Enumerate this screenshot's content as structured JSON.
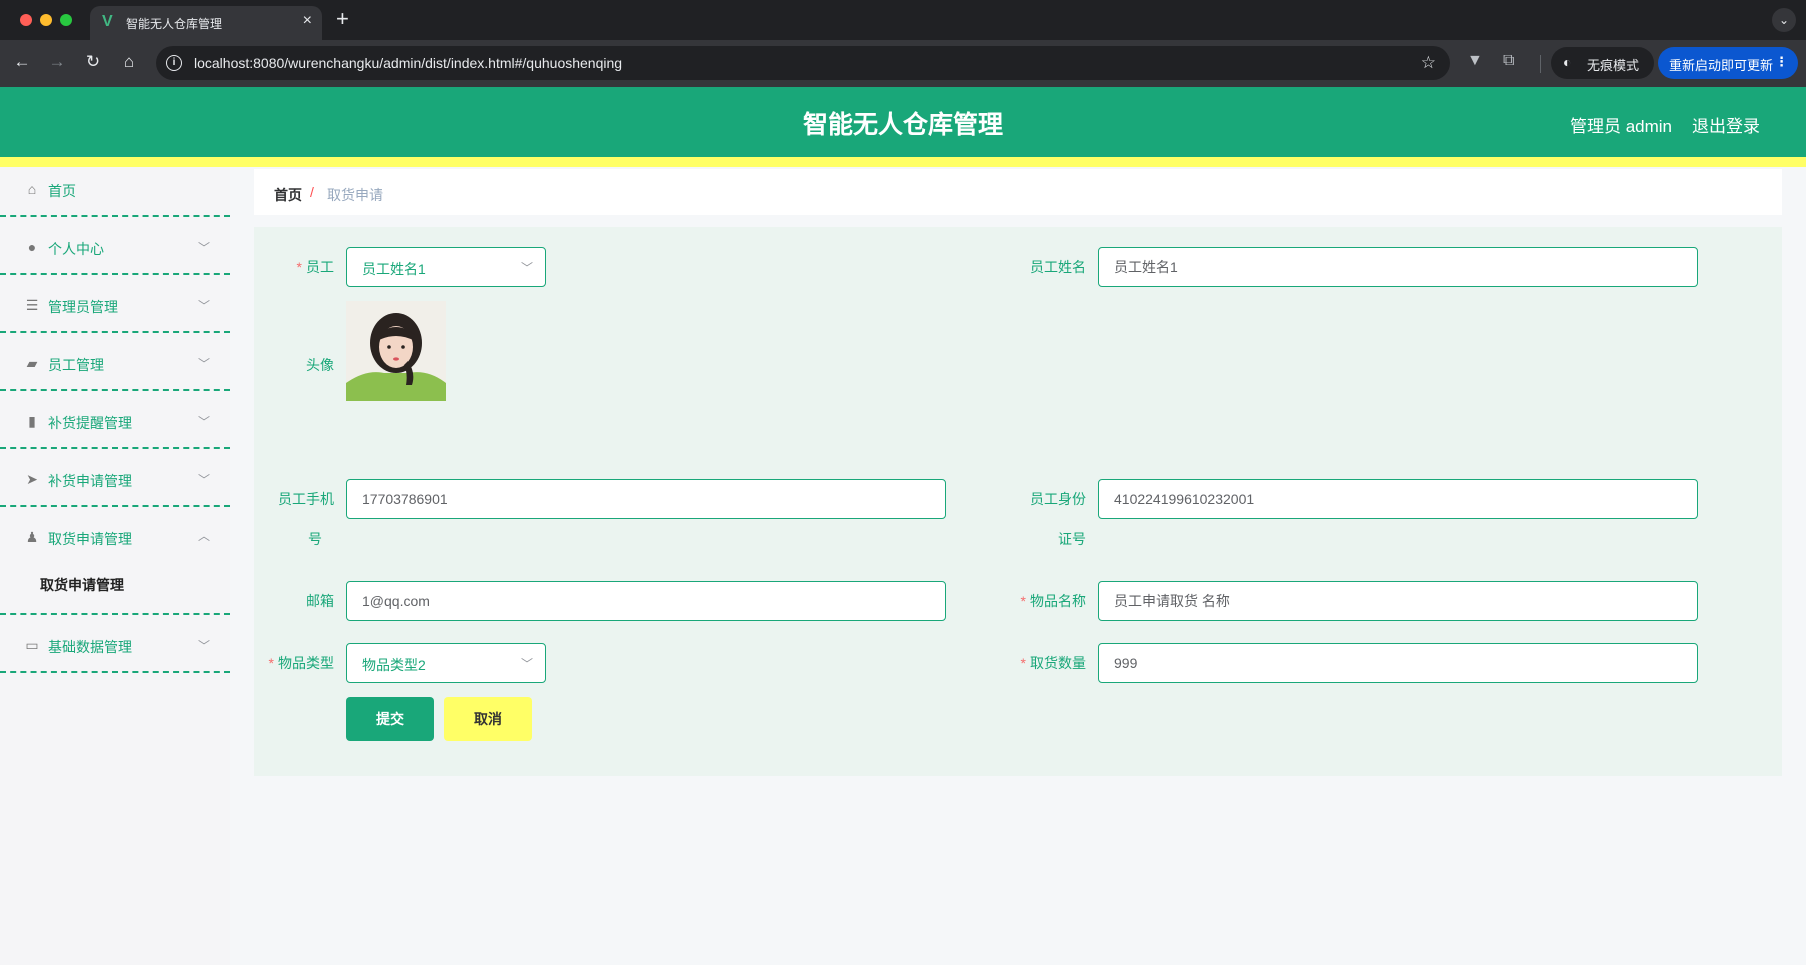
{
  "browser": {
    "tab_title": "智能无人仓库管理",
    "url": "localhost:8080/wurenchangku/admin/dist/index.html#/quhuoshenqing",
    "incognito_label": "无痕模式",
    "update_label": "重新启动即可更新",
    "icons": [
      "back-icon",
      "forward-icon",
      "reload-icon",
      "home-icon",
      "info-icon",
      "star-icon",
      "extension-icon",
      "incognito-icon",
      "menu-icon"
    ]
  },
  "header": {
    "title": "智能无人仓库管理",
    "user": "管理员 admin",
    "logout": "退出登录"
  },
  "colors": {
    "primary": "#19a779",
    "accent_yellow": "#ffff66",
    "required": "#f56c6c",
    "form_bg": "#ebf4f0"
  },
  "sidebar": {
    "items": [
      {
        "label": "首页",
        "icon": "home-icon"
      },
      {
        "label": "个人中心",
        "icon": "user-icon"
      },
      {
        "label": "管理员管理",
        "icon": "list-icon"
      },
      {
        "label": "员工管理",
        "icon": "wallet-icon"
      },
      {
        "label": "补货提醒管理",
        "icon": "bar-chart-icon"
      },
      {
        "label": "补货申请管理",
        "icon": "send-icon"
      },
      {
        "label": "取货申请管理",
        "icon": "stamp-icon",
        "submenu": [
          "取货申请管理"
        ]
      },
      {
        "label": "基础数据管理",
        "icon": "card-icon"
      }
    ]
  },
  "breadcrumb": {
    "home": "首页",
    "separator": "/",
    "current": "取货申请"
  },
  "form": {
    "employee": {
      "label": "员工",
      "value": "员工姓名1",
      "required": true
    },
    "employee_name": {
      "label": "员工姓名",
      "value": "员工姓名1"
    },
    "avatar": {
      "label": "头像"
    },
    "employee_phone": {
      "label_line1": "员工手机",
      "label_line2": "号",
      "value": "17703786901"
    },
    "employee_id_card": {
      "label_line1": "员工身份",
      "label_line2": "证号",
      "value": "410224199610232001"
    },
    "email": {
      "label": "邮箱",
      "value": "1@qq.com"
    },
    "item_name": {
      "label": "物品名称",
      "value": "员工申请取货 名称",
      "required": true
    },
    "item_type": {
      "label": "物品类型",
      "value": "物品类型2",
      "required": true
    },
    "pickup_quantity": {
      "label": "取货数量",
      "value": "999",
      "required": true
    },
    "submit_label": "提交",
    "cancel_label": "取消"
  }
}
